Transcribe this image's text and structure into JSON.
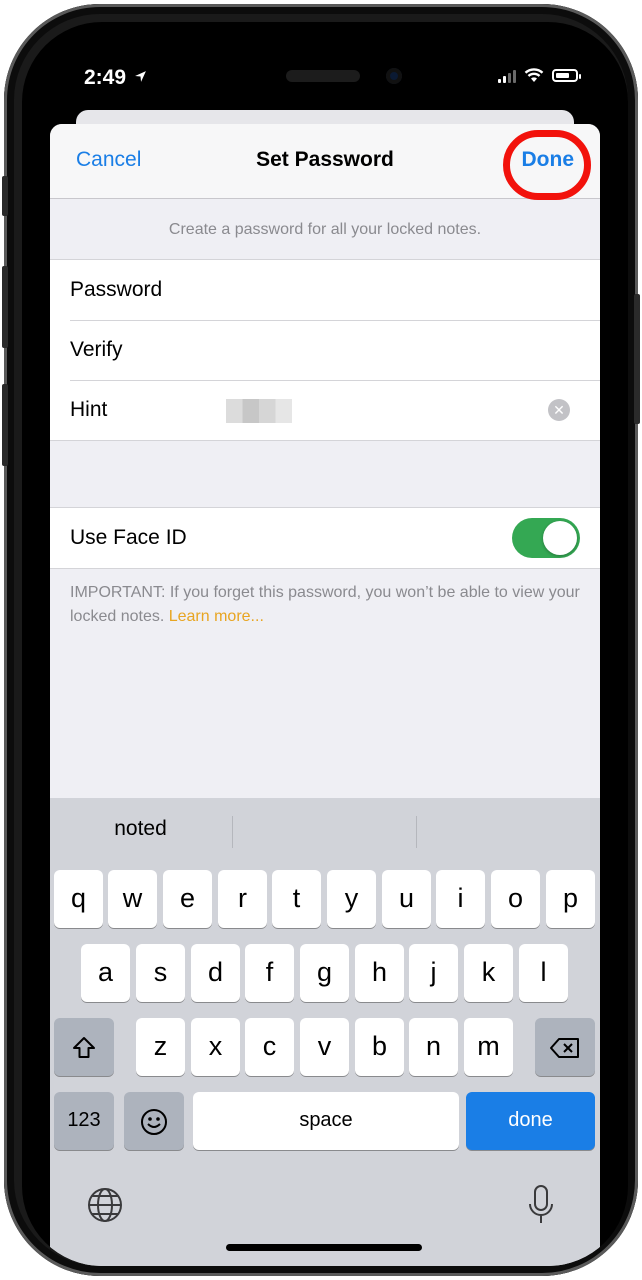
{
  "status": {
    "time": "2:49"
  },
  "nav": {
    "cancel": "Cancel",
    "title": "Set Password",
    "done": "Done"
  },
  "caption": "Create a password for all your locked notes.",
  "fields": [
    {
      "label": "Password"
    },
    {
      "label": "Verify"
    },
    {
      "label": "Hint"
    }
  ],
  "face_id": {
    "label": "Use Face ID",
    "enabled": true
  },
  "footnote": {
    "text": "IMPORTANT: If you forget this password, you won’t be able to view your locked notes.",
    "link": "Learn more..."
  },
  "keyboard": {
    "suggestions": [
      "noted",
      "",
      ""
    ],
    "row1": [
      "q",
      "w",
      "e",
      "r",
      "t",
      "y",
      "u",
      "i",
      "o",
      "p"
    ],
    "row2": [
      "a",
      "s",
      "d",
      "f",
      "g",
      "h",
      "j",
      "k",
      "l"
    ],
    "row3": [
      "z",
      "x",
      "c",
      "v",
      "b",
      "n",
      "m"
    ],
    "numbers": "123",
    "space": "space",
    "return": "done"
  },
  "colors": {
    "accent": "#1a7ee6",
    "toggle_on": "#34a853",
    "highlight": "#f2120c",
    "link": "#e8a521"
  },
  "icons": [
    "location-arrow-icon",
    "signal-icon",
    "wifi-icon",
    "battery-icon",
    "clear-icon",
    "shift-icon",
    "delete-icon",
    "emoji-icon",
    "globe-icon",
    "microphone-icon"
  ]
}
